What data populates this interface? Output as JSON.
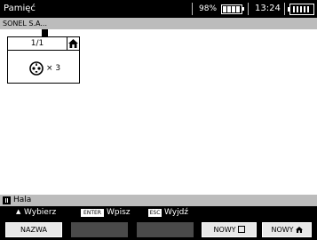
{
  "header": {
    "title": "Pamięć",
    "battery": "98%",
    "time": "13:24",
    "icons": [
      "battery-icon",
      "memory-card-icon"
    ]
  },
  "path": "SONEL S.A...",
  "card": {
    "number": "1/1",
    "count": "× 3",
    "icons": [
      "home-icon",
      "socket-icon"
    ]
  },
  "location": {
    "label": "Hala",
    "icon": "location-marker-icon"
  },
  "hints": {
    "select_arrow": "▲",
    "select": "Wybierz",
    "enter_key": "ENTER",
    "enter": "Wpisz",
    "esc_key": "ESC",
    "exit": "Wyjdź"
  },
  "buttons": {
    "f1": "NAZWA",
    "f4": "NOWY",
    "f5": "NOWY"
  }
}
